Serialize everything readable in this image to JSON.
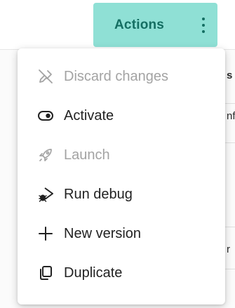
{
  "actions_button": {
    "label": "Actions",
    "icon": "kebab-menu-icon",
    "background": "#8fe0d5",
    "text_color": "#146e62"
  },
  "background_fragments": [
    {
      "text": "s",
      "bold": true
    },
    {
      "text": "nf",
      "bold": false
    },
    {
      "text": "r",
      "bold": false
    }
  ],
  "menu": {
    "items": [
      {
        "label": "Discard changes",
        "icon": "discard-icon",
        "enabled": false
      },
      {
        "label": "Activate",
        "icon": "toggle-icon",
        "enabled": true
      },
      {
        "label": "Launch",
        "icon": "rocket-icon",
        "enabled": false
      },
      {
        "label": "Run debug",
        "icon": "bug-play-icon",
        "enabled": true
      },
      {
        "label": "New version",
        "icon": "plus-icon",
        "enabled": true
      },
      {
        "label": "Duplicate",
        "icon": "duplicate-icon",
        "enabled": true
      }
    ]
  },
  "colors": {
    "enabled_text": "#222222",
    "disabled_text": "#a3a3a3"
  }
}
